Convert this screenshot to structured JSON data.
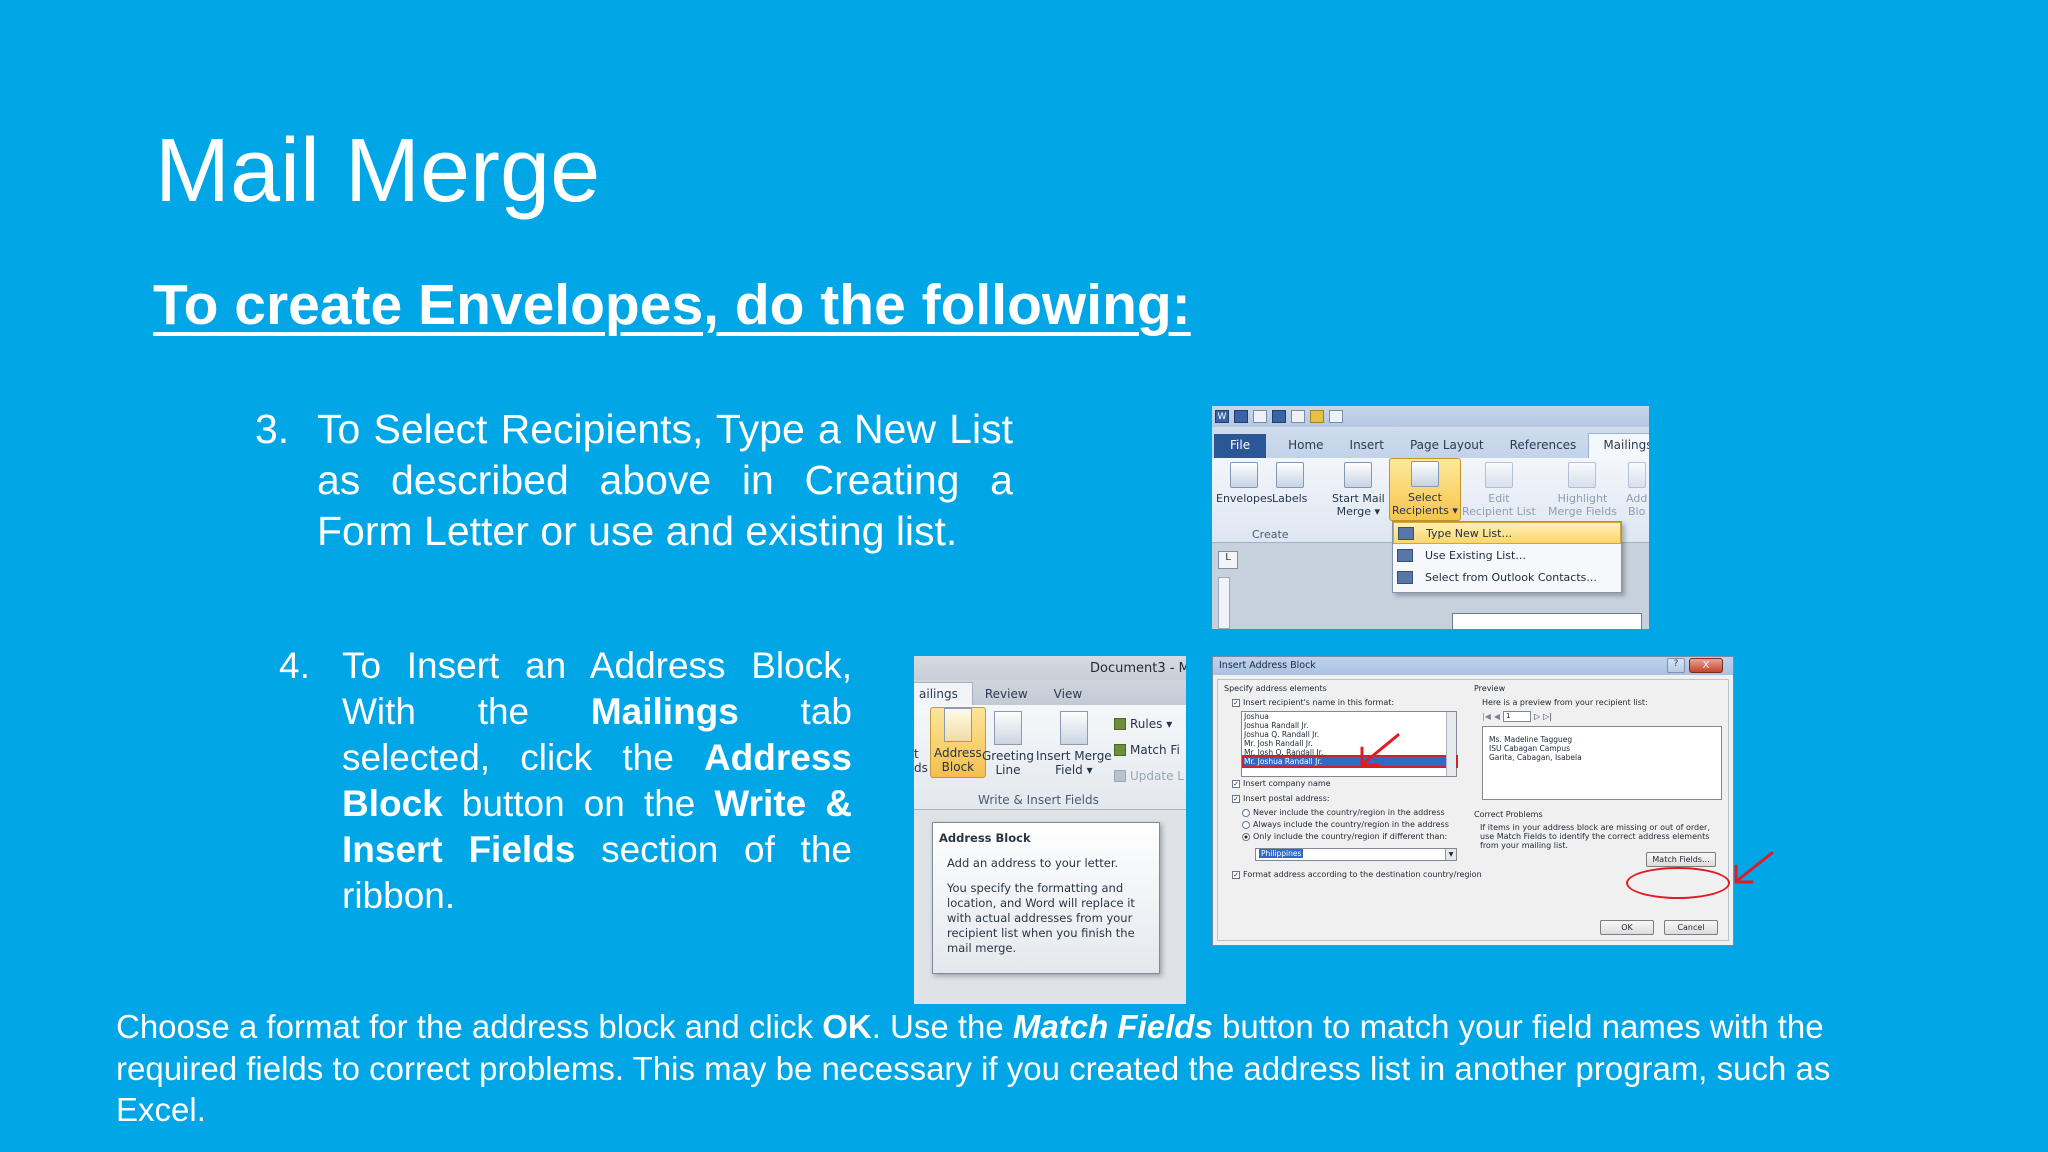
{
  "slide": {
    "title": "Mail Merge",
    "subtitle": "To create Envelopes, do the following:",
    "step3": {
      "number": "3.",
      "text": "To Select Recipients, Type a New List as described above in Creating a Form Letter or use and existing list."
    },
    "step4": {
      "number": "4.",
      "parts": [
        "To Insert an Address Block, With the ",
        "Mailings",
        " tab selected, click the ",
        "Address Block",
        " button on the ",
        "Write & Insert Fields",
        " section of the ribbon."
      ]
    },
    "footer": {
      "parts": [
        "Choose a format for the address block and click ",
        "OK",
        ".  Use the ",
        "Match Fields",
        " button to match your field names with the required fields to correct problems. This may be necessary if you created the address list in another program, such as Excel."
      ]
    }
  },
  "ribbon_screenshot": {
    "tabs": [
      "File",
      "Home",
      "Insert",
      "Page Layout",
      "References",
      "Mailings"
    ],
    "buttons": {
      "envelopes": "Envelopes",
      "labels": "Labels",
      "start_mail_merge": [
        "Start Mail",
        "Merge ▾"
      ],
      "select_recipients": [
        "Select",
        "Recipients ▾"
      ],
      "edit_recipient_list": [
        "Edit",
        "Recipient List"
      ],
      "highlight_merge_fields": [
        "Highlight",
        "Merge Fields"
      ],
      "address_block_partial": [
        "Add",
        "Blo"
      ]
    },
    "group_create": "Create",
    "dropdown": [
      "Type New List...",
      "Use Existing List...",
      "Select from Outlook Contacts..."
    ],
    "ruler_mark": "L"
  },
  "write_screenshot": {
    "doc_title": "Document3 - M",
    "tabs": [
      "ailings",
      "Review",
      "View"
    ],
    "buttons": {
      "partial_left": [
        "t",
        "ds"
      ],
      "address_block": [
        "Address",
        "Block"
      ],
      "greeting_line": [
        "Greeting",
        "Line"
      ],
      "insert_merge_field": [
        "Insert Merge",
        "Field ▾"
      ]
    },
    "small": [
      "Rules ▾",
      "Match Fi",
      "Update L"
    ],
    "group": "Write & Insert Fields",
    "tooltip": {
      "title": "Address Block",
      "line1": "Add an address to your letter.",
      "line2": "You specify the formatting and location, and Word will replace it with actual addresses from your recipient list when you finish the mail merge."
    }
  },
  "dialog_screenshot": {
    "title": "Insert Address Block",
    "help": "?",
    "close": "X",
    "specify_label": "Specify address elements",
    "insert_name_label": "Insert recipient's name in this format:",
    "name_formats": [
      "Joshua",
      "Joshua Randall Jr.",
      "Joshua Q. Randall Jr.",
      "Mr. Josh Randall Jr.",
      "Mr. Josh Q. Randall Jr.",
      "Mr. Joshua Randall Jr."
    ],
    "insert_company": "Insert company name",
    "insert_postal": "Insert postal address:",
    "never_include": "Never include the country/region in the address",
    "always_include": "Always include the country/region in the address",
    "only_include": "Only include the country/region if different than:",
    "country": "Philippines",
    "format_address": "Format address according to the destination country/region",
    "preview_label": "Preview",
    "preview_hint": "Here is a preview from your recipient list:",
    "record": "1",
    "preview_lines": [
      "Ms. Madeline Taggueg",
      "ISU Cabagan Campus",
      "Garita, Cabagan, Isabela"
    ],
    "correct_label": "Correct Problems",
    "correct_text": "If items in your address block are missing or out of order, use Match Fields to identify the correct address elements from your mailing list.",
    "match_fields": "Match Fields...",
    "ok": "OK",
    "cancel": "Cancel"
  },
  "colors": {
    "background": "#01a6e6",
    "text": "#ffffff",
    "annotation": "#e01b22"
  }
}
